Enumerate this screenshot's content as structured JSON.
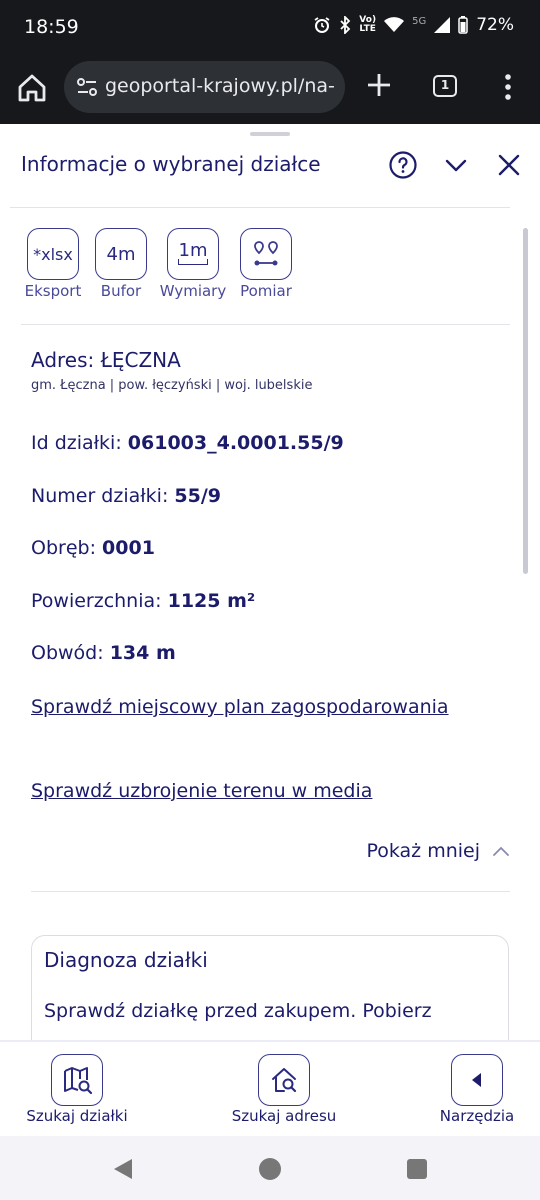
{
  "status_bar": {
    "time": "18:59",
    "network_label": "5G",
    "battery": "72%"
  },
  "browser": {
    "url": "geoportal-krajowy.pl/na-",
    "tab_count": "1"
  },
  "panel": {
    "title": "Informacje o wybranej działce",
    "tools": [
      {
        "icon_text": "*xlsx",
        "label": "Eksport"
      },
      {
        "icon_text": "4m",
        "label": "Bufor"
      },
      {
        "icon_text": "1m",
        "label": "Wymiary"
      },
      {
        "icon_text": "",
        "label": "Pomiar"
      }
    ],
    "address_title": "Adres: ŁĘCZNA",
    "address_sub": "gm. Łęczna | pow. łęczyński | woj. lubelskie",
    "fields": [
      {
        "label": "Id działki: ",
        "value": "061003_4.0001.55/9"
      },
      {
        "label": "Numer działki: ",
        "value": "55/9"
      },
      {
        "label": "Obręb: ",
        "value": "0001"
      },
      {
        "label": "Powierzchnia: ",
        "value": "1125 m²"
      },
      {
        "label": "Obwód: ",
        "value": "134 m"
      }
    ],
    "link_plan": "Sprawdź miejscowy plan zagospodarowania",
    "link_media": "Sprawdź uzbrojenie terenu w media",
    "show_less": "Pokaż mniej",
    "diagnosis_title": "Diagnoza działki",
    "diagnosis_text": "Sprawdź działkę przed zakupem. Pobierz"
  },
  "bottom_nav": [
    {
      "label": "Szukaj działki"
    },
    {
      "label": "Szukaj adresu"
    },
    {
      "label": "Narzędzia"
    }
  ],
  "colors": {
    "primary": "#1c1c6b",
    "accent": "#3a3a8c",
    "browser_bg": "#16181b"
  }
}
